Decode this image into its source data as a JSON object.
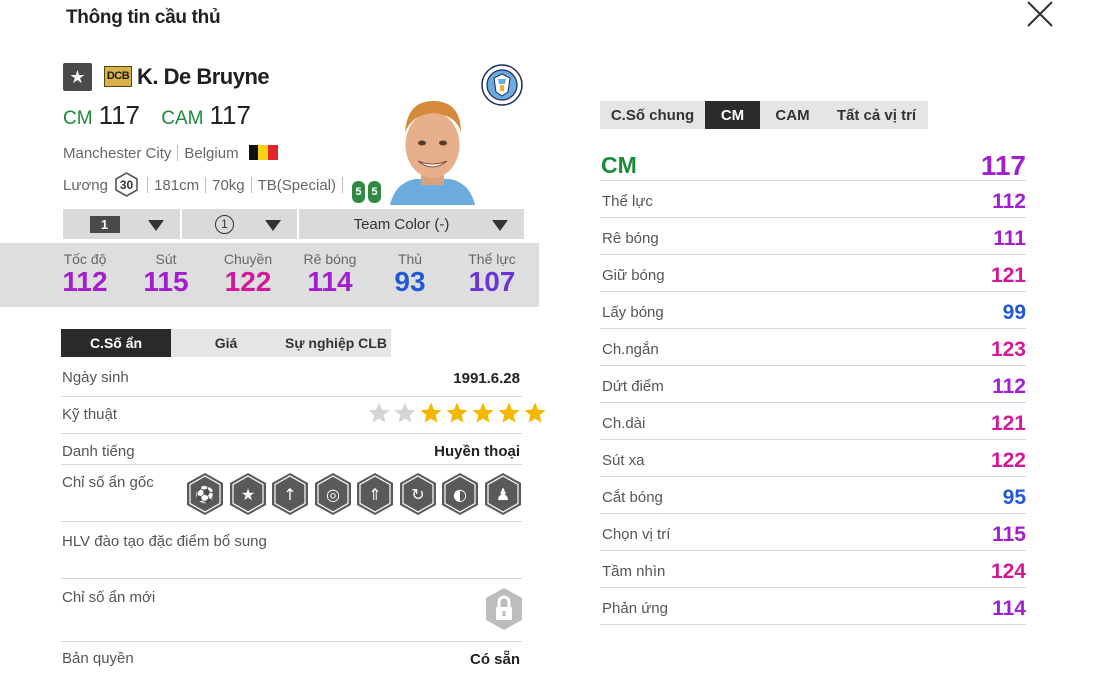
{
  "header": {
    "title": "Thông tin cầu thủ",
    "close_icon": "close-icon"
  },
  "player": {
    "name": "K. De Bruyne",
    "season_badge": "DCB",
    "positions": [
      {
        "pos": "CM",
        "ovr": "117"
      },
      {
        "pos": "CAM",
        "ovr": "117"
      }
    ],
    "club": "Manchester City",
    "nationality": "Belgium",
    "salary_label": "Lương",
    "salary": "30",
    "height": "181cm",
    "weight": "70kg",
    "body_type": "TB(Special)",
    "weak_foot_left": "5",
    "weak_foot_right": "5",
    "club_logo": "manchester-city-crest",
    "flag_colors": [
      "#111111",
      "#f7d117",
      "#e3262c"
    ]
  },
  "selectors": {
    "upgrade_level": "1",
    "team_chem": "①",
    "team_color": "Team Color (-)"
  },
  "summary_stats": [
    {
      "label": "Tốc độ",
      "value": "112",
      "color": "#a21fd0"
    },
    {
      "label": "Sút",
      "value": "115",
      "color": "#a21fd0"
    },
    {
      "label": "Chuyền",
      "value": "122",
      "color": "#d5179a"
    },
    {
      "label": "Rê bóng",
      "value": "114",
      "color": "#a21fd0"
    },
    {
      "label": "Thủ",
      "value": "93",
      "color": "#2358d6"
    },
    {
      "label": "Thể lực",
      "value": "107",
      "color": "#6a35d6"
    }
  ],
  "left_tabs": [
    "C.Số ẩn",
    "Giá",
    "Sự nghiệp CLB"
  ],
  "details": {
    "birth_label": "Ngày sinh",
    "birth": "1991.6.28",
    "skill_label": "Kỹ thuật",
    "skill_stars": 5,
    "skill_stars_max": 7,
    "rep_label": "Danh tiếng",
    "rep": "Huyền thoại",
    "traits_label": "Chỉ số ẩn gốc",
    "traits": [
      "trait-power-header-icon",
      "trait-flair-icon",
      "trait-long-shot-icon",
      "trait-playmaker-icon",
      "trait-finesse-icon",
      "trait-outside-foot-icon",
      "trait-stamina-icon",
      "trait-team-player-icon"
    ],
    "coach_label": "HLV đào tạo đặc điểm bổ sung",
    "new_traits_label": "Chỉ số ẩn mới",
    "license_label": "Bản quyền",
    "license": "Có sẵn"
  },
  "right_tabs": [
    "C.Số chung",
    "CM",
    "CAM",
    "Tất cả vị trí"
  ],
  "position_rating": {
    "label": "CM",
    "value": "117",
    "color": "#a21fd0"
  },
  "attributes": [
    {
      "label": "Thể lực",
      "value": "112",
      "color": "#a21fd0"
    },
    {
      "label": "Rê bóng",
      "value": "111",
      "color": "#a21fd0"
    },
    {
      "label": "Giữ bóng",
      "value": "121",
      "color": "#d5179a"
    },
    {
      "label": "Lấy bóng",
      "value": "99",
      "color": "#2358d6"
    },
    {
      "label": "Ch.ngắn",
      "value": "123",
      "color": "#d5179a"
    },
    {
      "label": "Dứt điểm",
      "value": "112",
      "color": "#a21fd0"
    },
    {
      "label": "Ch.dài",
      "value": "121",
      "color": "#d5179a"
    },
    {
      "label": "Sút xa",
      "value": "122",
      "color": "#d5179a"
    },
    {
      "label": "Cắt bóng",
      "value": "95",
      "color": "#2358d6"
    },
    {
      "label": "Chọn vị trí",
      "value": "115",
      "color": "#a21fd0"
    },
    {
      "label": "Tầm nhìn",
      "value": "124",
      "color": "#d5179a"
    },
    {
      "label": "Phản ứng",
      "value": "114",
      "color": "#a21fd0"
    }
  ]
}
